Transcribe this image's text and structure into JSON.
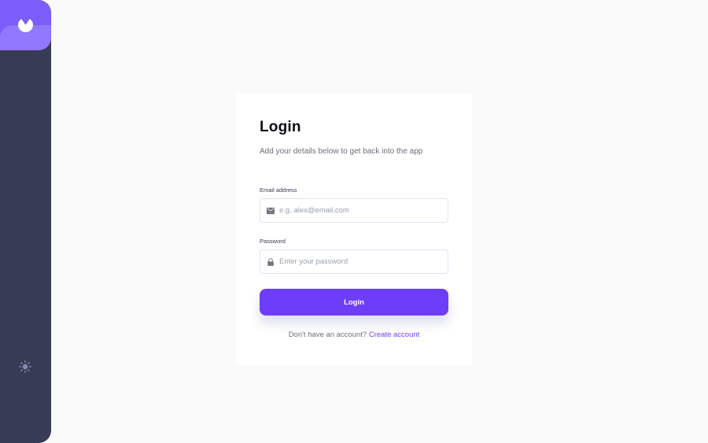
{
  "sidebar": {
    "logo_icon": "app-logo-icon",
    "theme_icon": "sun-icon",
    "background": "#373b53",
    "accent": "#7c5dfa"
  },
  "login": {
    "title": "Login",
    "subtitle": "Add your details below to get back into the app",
    "email": {
      "label": "Email address",
      "placeholder": "e.g. alex@email.com",
      "value": "",
      "icon": "envelope-icon"
    },
    "password": {
      "label": "Password",
      "placeholder": "Enter your password",
      "value": "",
      "icon": "lock-icon"
    },
    "submit_label": "Login",
    "footer_prompt": "Don't have an account?",
    "create_account_label": "Create account"
  }
}
